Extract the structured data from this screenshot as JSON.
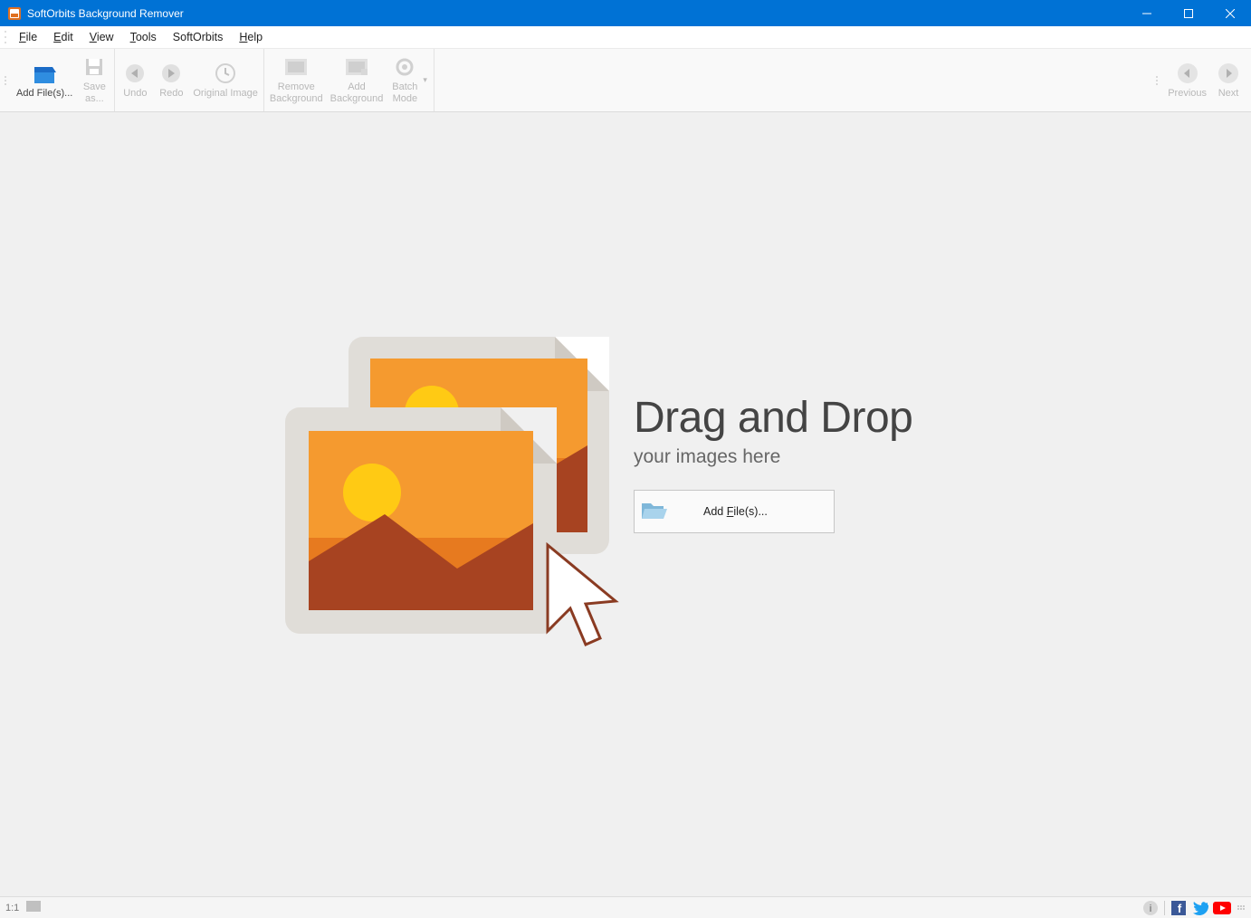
{
  "window": {
    "title": "SoftOrbits Background Remover"
  },
  "menu": {
    "file": "File",
    "file_u": "F",
    "edit": "Edit",
    "edit_u": "E",
    "view": "View",
    "view_u": "V",
    "tools": "Tools",
    "tools_u": "T",
    "softorbits": "SoftOrbits",
    "help": "Help",
    "help_u": "H"
  },
  "toolbar": {
    "add_files": "Add File(s)...",
    "save_as": "Save as...",
    "save_as_u": "S",
    "undo": "Undo",
    "undo_u": "U",
    "redo": "Redo",
    "redo_u": "R",
    "original_image": "Original Image",
    "remove_bg": "Remove Background",
    "add_bg": "Add Background",
    "batch_mode": "Batch Mode",
    "previous": "Previous",
    "next": "Next"
  },
  "workspace": {
    "title": "Drag and Drop",
    "subtitle": "your images here",
    "add_files_btn_prefix": "Add ",
    "add_files_btn_u": "F",
    "add_files_btn_suffix": "ile(s)..."
  },
  "status": {
    "zoom": "1:1"
  },
  "colors": {
    "accent": "#0072d5"
  }
}
